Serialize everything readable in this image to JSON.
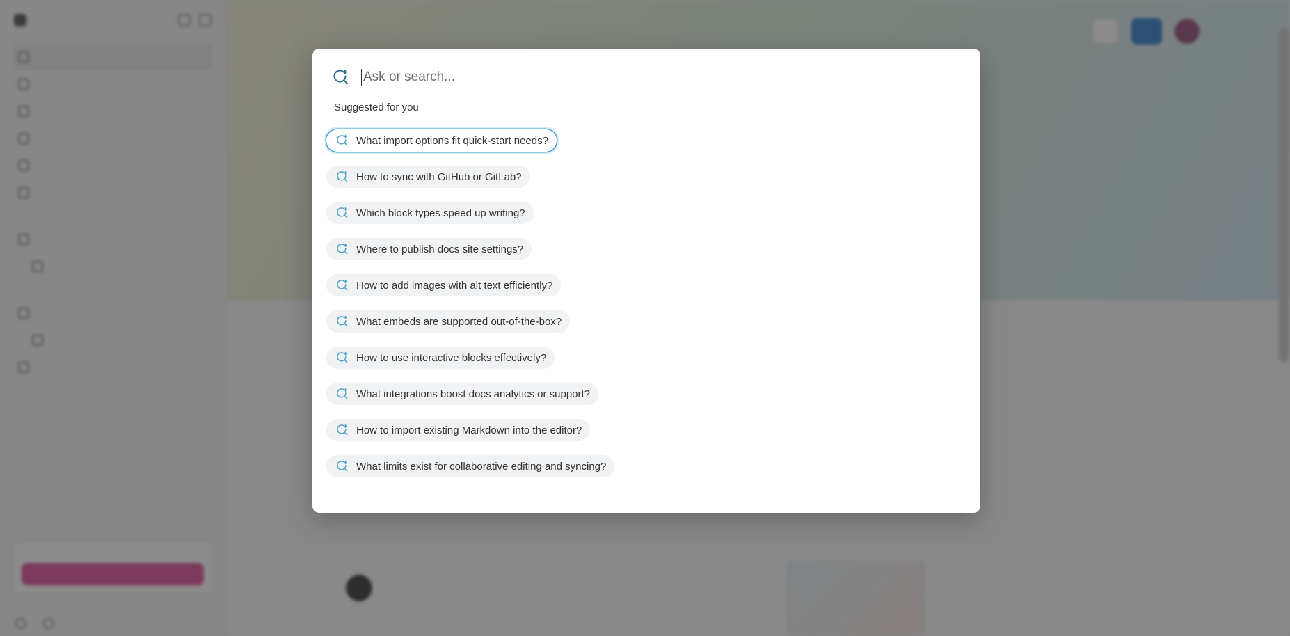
{
  "search": {
    "placeholder": "Ask or search...",
    "icon": "ask-ai-search-icon"
  },
  "suggestions_section": {
    "label": "Suggested for you",
    "selected_index": 0,
    "icon": "ask-ai-search-icon",
    "items": [
      "What import options fit quick-start needs?",
      "How to sync with GitHub or GitLab?",
      "Which block types speed up writing?",
      "Where to publish docs site settings?",
      "How to add images with alt text efficiently?",
      "What embeds are supported out-of-the-box?",
      "How to use interactive blocks effectively?",
      "What integrations boost docs analytics or support?",
      "How to import existing Markdown into the editor?",
      "What limits exist for collaborative editing and syncing?"
    ]
  },
  "colors": {
    "accent": "#4aa3c9",
    "overlay": "#373737",
    "chip_bg": "#f1f2f3",
    "primary_button": "#1d73c9",
    "trial_button": "#e13e8c"
  }
}
